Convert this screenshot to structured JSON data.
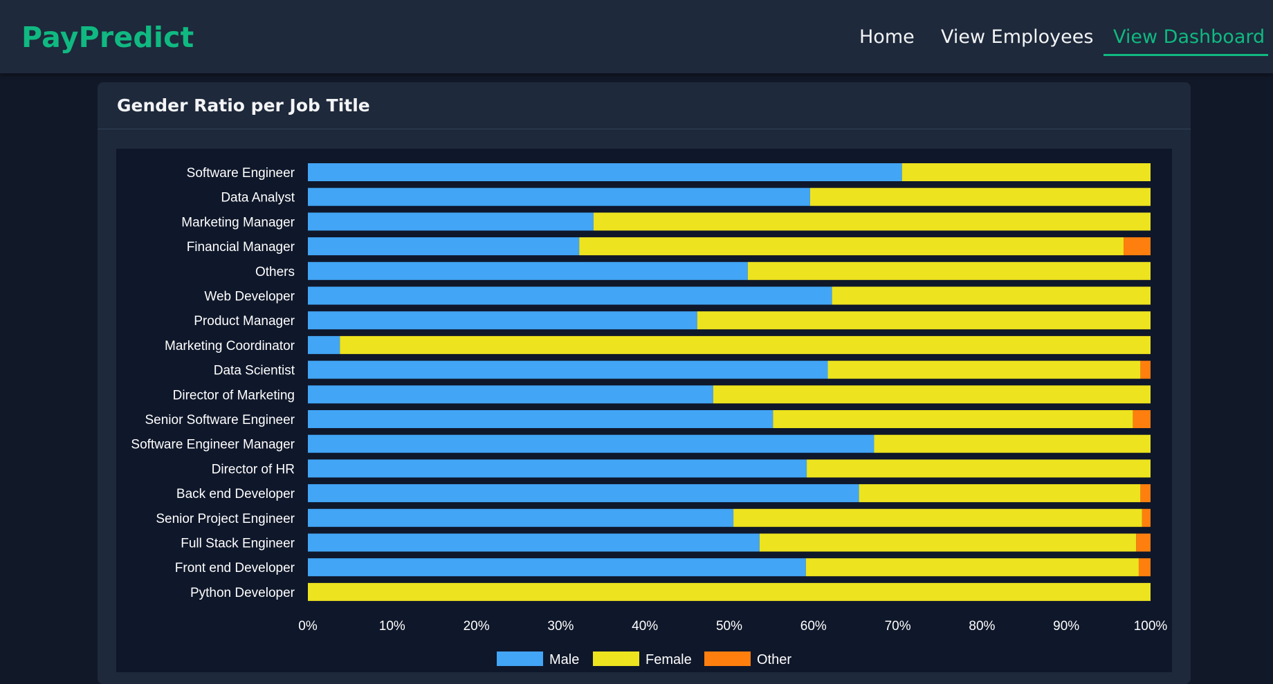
{
  "header": {
    "brand": "PayPredict",
    "nav": [
      {
        "label": "Home",
        "active": false
      },
      {
        "label": "View Employees",
        "active": false
      },
      {
        "label": "View Dashboard",
        "active": true
      }
    ]
  },
  "card": {
    "title": "Gender Ratio per Job Title"
  },
  "colors": {
    "male": "#42a5f5",
    "female": "#ede31f",
    "other": "#ff7f0e",
    "accent": "#10b981"
  },
  "chart_data": {
    "type": "bar",
    "orientation": "horizontal",
    "stacked": true,
    "categories": [
      "Software Engineer",
      "Data Analyst",
      "Marketing Manager",
      "Financial Manager",
      "Others",
      "Web Developer",
      "Product Manager",
      "Marketing Coordinator",
      "Data Scientist",
      "Director of Marketing",
      "Senior Software Engineer",
      "Software Engineer Manager",
      "Director of HR",
      "Back end Developer",
      "Senior Project Engineer",
      "Full Stack Engineer",
      "Front end Developer",
      "Python Developer"
    ],
    "series": [
      {
        "name": "Male",
        "values": [
          70.5,
          59.6,
          33.9,
          32.2,
          52.2,
          62.2,
          46.2,
          3.8,
          61.7,
          48.1,
          55.2,
          67.2,
          59.2,
          65.4,
          50.5,
          53.6,
          59.1,
          0
        ]
      },
      {
        "name": "Female",
        "values": [
          29.5,
          40.4,
          66.1,
          64.6,
          47.8,
          37.8,
          53.8,
          96.2,
          37.1,
          51.9,
          42.7,
          32.8,
          40.8,
          33.4,
          48.5,
          44.7,
          39.5,
          100
        ]
      },
      {
        "name": "Other",
        "values": [
          0,
          0,
          0,
          3.2,
          0,
          0,
          0,
          0,
          1.2,
          0,
          2.1,
          0,
          0,
          1.2,
          1.0,
          1.7,
          1.4,
          0
        ]
      }
    ],
    "x_ticks": [
      "0%",
      "10%",
      "20%",
      "30%",
      "40%",
      "50%",
      "60%",
      "70%",
      "80%",
      "90%",
      "100%"
    ],
    "xlim": [
      0,
      100
    ],
    "legend": [
      "Male",
      "Female",
      "Other"
    ],
    "legend_position": "bottom",
    "grid": false
  }
}
